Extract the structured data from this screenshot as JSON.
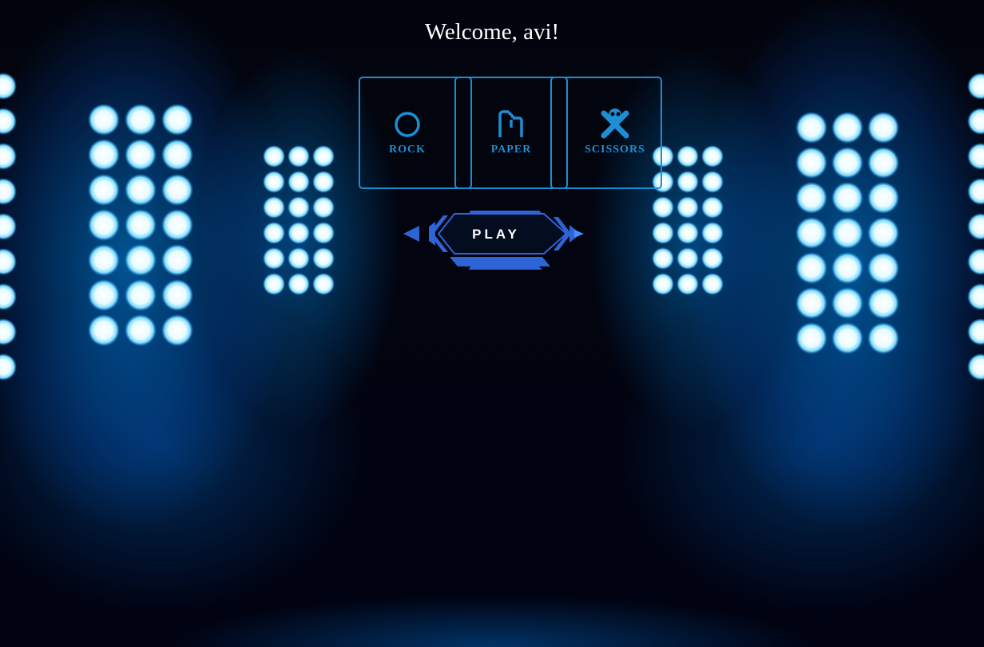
{
  "header": {
    "welcome": "Welcome, avi!"
  },
  "choices": [
    {
      "id": "rock",
      "label": "ROCK",
      "icon": "circle-icon"
    },
    {
      "id": "paper",
      "label": "PAPER",
      "icon": "paper-icon"
    },
    {
      "id": "scissors",
      "label": "SCISSORS",
      "icon": "scissors-icon"
    }
  ],
  "play_button": {
    "label": "PLAY"
  },
  "colors": {
    "accent": "#1e8fd2",
    "button_blue": "#2f64d6",
    "background": "#02040c",
    "light": "#bfefff"
  }
}
